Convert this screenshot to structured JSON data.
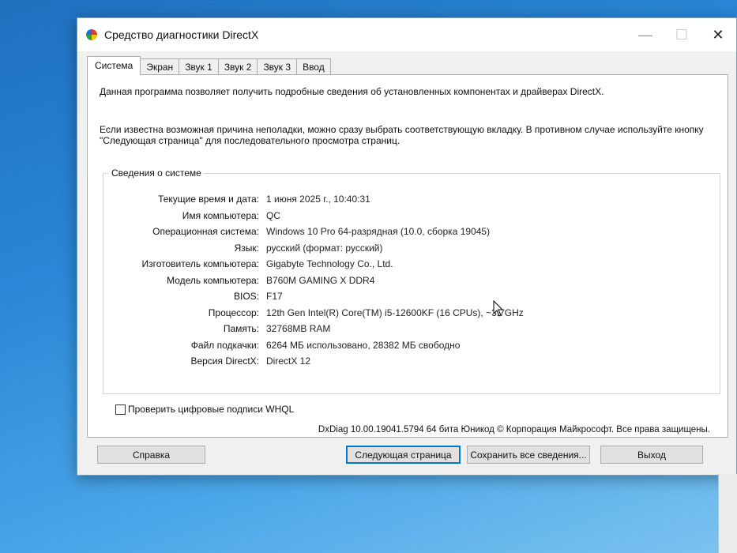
{
  "window": {
    "title": "Средство диагностики DirectX",
    "controls": {
      "minimize": "—",
      "maximize": "☐",
      "close": "✕"
    }
  },
  "tabs": [
    {
      "label": "Система",
      "active": true
    },
    {
      "label": "Экран",
      "active": false
    },
    {
      "label": "Звук 1",
      "active": false
    },
    {
      "label": "Звук 2",
      "active": false
    },
    {
      "label": "Звук 3",
      "active": false
    },
    {
      "label": "Ввод",
      "active": false
    }
  ],
  "intro": {
    "line1": "Данная программа позволяет получить подробные сведения об установленных компонентах и драйверах DirectX.",
    "line2": "Если известна возможная причина неполадки, можно сразу выбрать соответствующую вкладку. В противном случае используйте кнопку \"Следующая страница\" для последовательного просмотра страниц."
  },
  "system_info": {
    "group_title": "Сведения о системе",
    "rows": [
      {
        "label": "Текущие время и дата:",
        "value": "1 июня 2025 г., 10:40:31"
      },
      {
        "label": "Имя компьютера:",
        "value": "QC"
      },
      {
        "label": "Операционная система:",
        "value": "Windows 10 Pro 64-разрядная (10.0, сборка 19045)"
      },
      {
        "label": "Язык:",
        "value": "русский (формат: русский)"
      },
      {
        "label": "Изготовитель компьютера:",
        "value": "Gigabyte Technology Co., Ltd."
      },
      {
        "label": "Модель компьютера:",
        "value": "B760M GAMING X DDR4"
      },
      {
        "label": "BIOS:",
        "value": "F17"
      },
      {
        "label": "Процессор:",
        "value": "12th Gen Intel(R) Core(TM) i5-12600KF (16 CPUs), ~3.7GHz"
      },
      {
        "label": "Память:",
        "value": "32768MB RAM"
      },
      {
        "label": "Файл подкачки:",
        "value": "6264 МБ использовано, 28382 МБ свободно"
      },
      {
        "label": "Версия DirectX:",
        "value": "DirectX 12"
      }
    ]
  },
  "whql": {
    "label": "Проверить цифровые подписи WHQL",
    "checked": false
  },
  "footer": "DxDiag 10.00.19041.5794 64 бита Юникод © Корпорация Майкрософт. Все права защищены.",
  "buttons": {
    "help": "Справка",
    "next": "Следующая страница",
    "save": "Сохранить все сведения...",
    "exit": "Выход"
  },
  "colors": {
    "accent": "#0078d7",
    "desktop": "#2a86d6"
  }
}
